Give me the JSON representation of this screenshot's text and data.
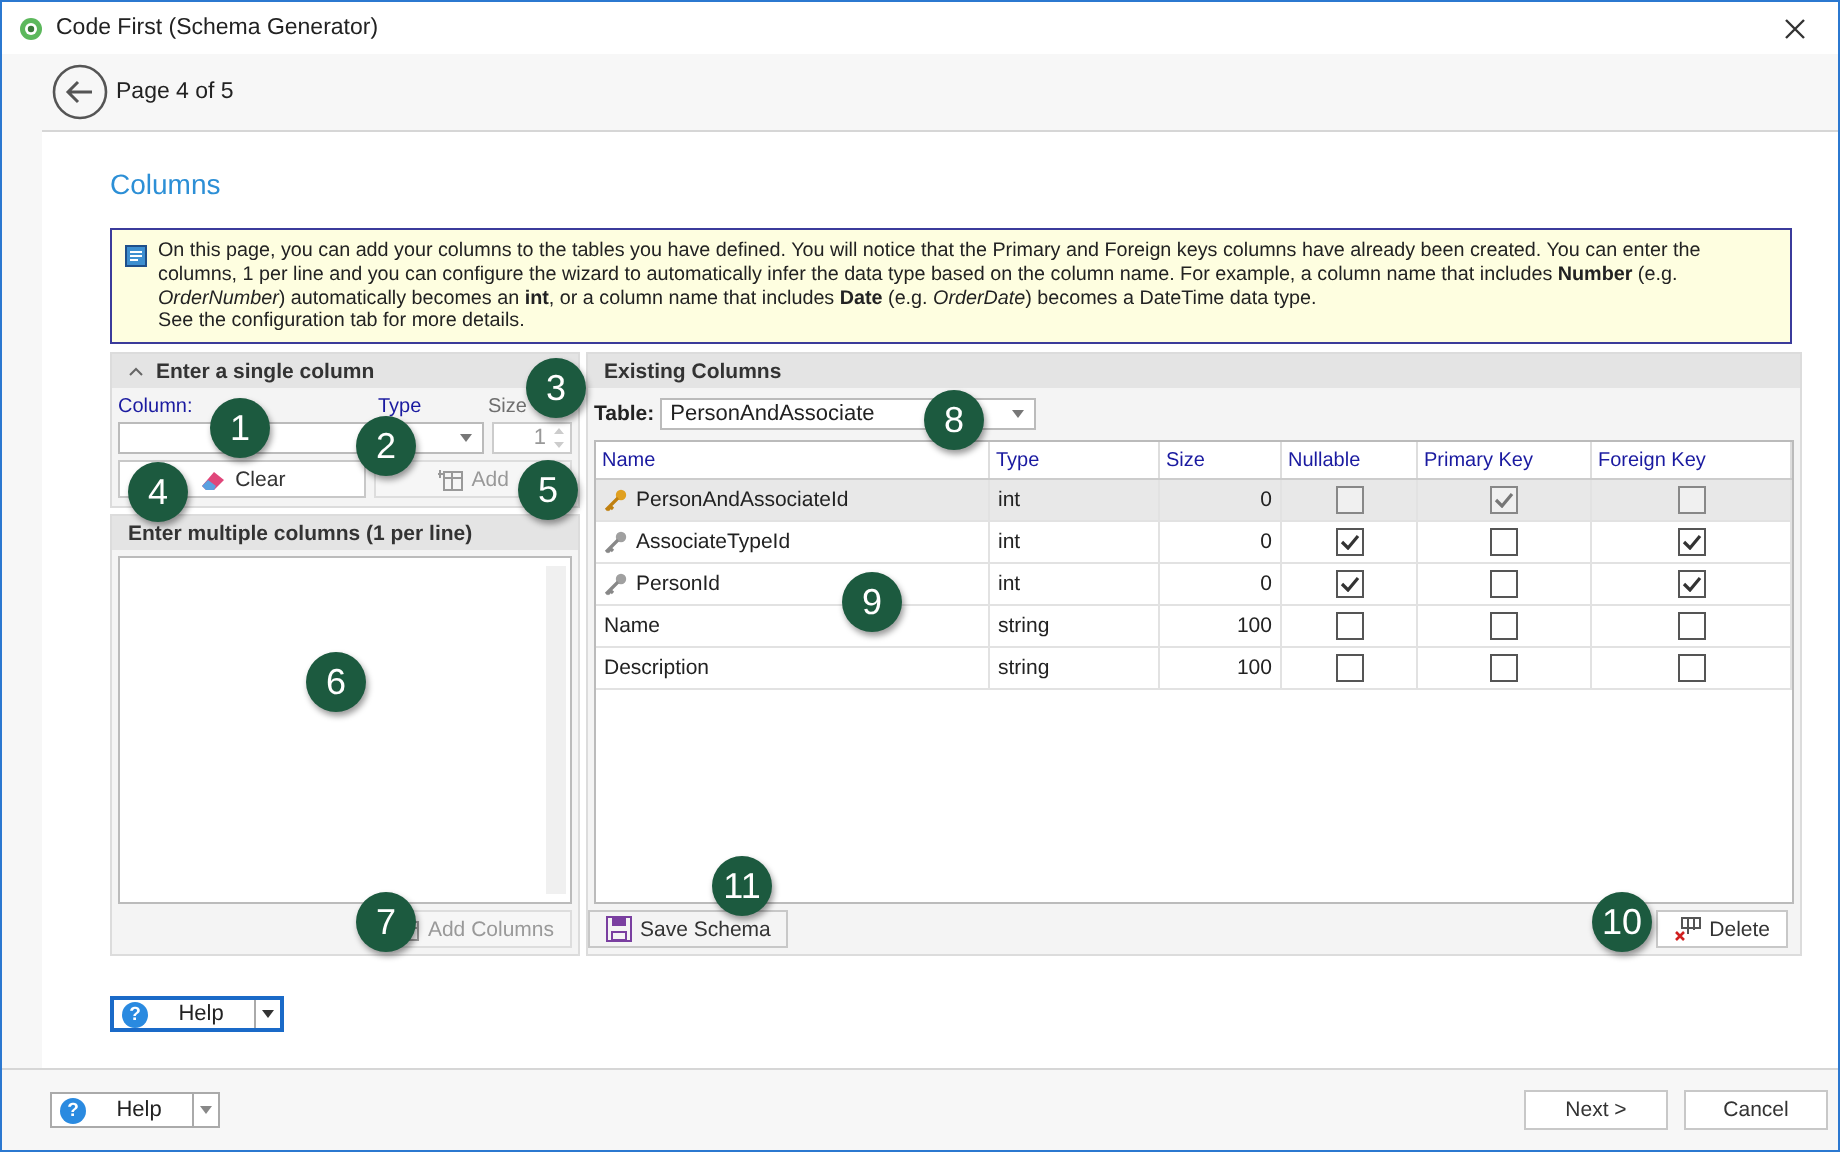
{
  "window": {
    "title": "Code First (Schema Generator)"
  },
  "header": {
    "page": "Page 4 of 5"
  },
  "page_title": "Columns",
  "info": "On this page, you can add your columns to the tables you have defined. You will notice that the Primary and Foreign keys columns have already been created. You can enter the columns, 1 per line and you can configure the wizard to automatically infer the data type based on the column name. For example, a column name that includes **Number** (e.g. *OrderNumber*) automatically becomes an **int**, or a column name that includes **Date** (e.g. *OrderDate*) becomes a DateTime data type.\nSee the configuration tab for more details.",
  "single": {
    "title": "Enter a single column",
    "expanded": true,
    "column_label": "Column:",
    "type_label": "Type",
    "size_label": "Size",
    "size_value": "1",
    "clear": "Clear",
    "add": "Add",
    "add_disabled": true
  },
  "multiple": {
    "title": "Enter multiple columns  (1 per line)",
    "add_columns": "Add Columns",
    "add_disabled": true
  },
  "existing": {
    "title": "Existing Columns",
    "table_label": "Table:",
    "table_value": "PersonAndAssociate",
    "columns": [
      "Name",
      "Type",
      "Size",
      "Nullable",
      "Primary Key",
      "Foreign Key"
    ],
    "rows": [
      {
        "name": "PersonAndAssociateId",
        "type": "int",
        "size": "0",
        "kind": "primary",
        "nullable": false,
        "primary_key": true,
        "foreign_key": false,
        "selected": true
      },
      {
        "name": "AssociateTypeId",
        "type": "int",
        "size": "0",
        "kind": "foreign",
        "nullable": true,
        "primary_key": false,
        "foreign_key": true,
        "selected": false
      },
      {
        "name": "PersonId",
        "type": "int",
        "size": "0",
        "kind": "foreign",
        "nullable": true,
        "primary_key": false,
        "foreign_key": true,
        "selected": false
      },
      {
        "name": "Name",
        "type": "string",
        "size": "100",
        "kind": "none",
        "nullable": false,
        "primary_key": false,
        "foreign_key": false,
        "selected": false
      },
      {
        "name": "Description",
        "type": "string",
        "size": "100",
        "kind": "none",
        "nullable": false,
        "primary_key": false,
        "foreign_key": false,
        "selected": false
      }
    ],
    "save": "Save Schema",
    "delete": "Delete"
  },
  "help_button": {
    "icon": "?",
    "label": "Help"
  },
  "footer": {
    "help_icon": "?",
    "help": "Help",
    "next": "Next >",
    "cancel": "Cancel"
  },
  "callouts": [
    "1",
    "2",
    "3",
    "4",
    "5",
    "6",
    "7",
    "8",
    "9",
    "10",
    "11"
  ]
}
